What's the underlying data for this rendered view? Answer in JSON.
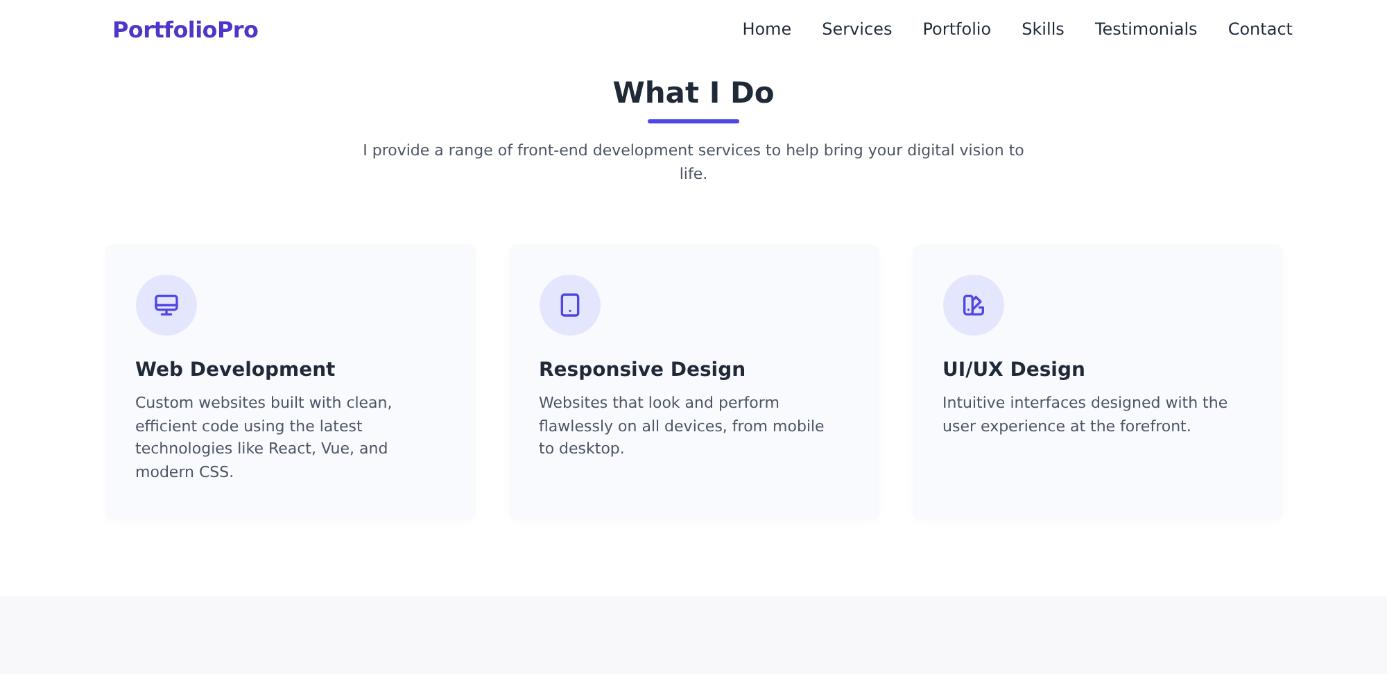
{
  "header": {
    "logo": "PortfolioPro",
    "nav": [
      {
        "label": "Home"
      },
      {
        "label": "Services"
      },
      {
        "label": "Portfolio"
      },
      {
        "label": "Skills"
      },
      {
        "label": "Testimonials"
      },
      {
        "label": "Contact"
      }
    ]
  },
  "section": {
    "title": "What I Do",
    "intro": "I provide a range of front-end development services to help bring your digital vision to life.",
    "services": [
      {
        "kind": "monitor",
        "title": "Web Development",
        "text": "Custom websites built with clean, efficient code using the latest technologies like React, Vue, and modern CSS."
      },
      {
        "kind": "tablet",
        "title": "Responsive Design",
        "text": "Websites that look and perform flawlessly on all devices, from mobile to desktop."
      },
      {
        "kind": "palette",
        "title": "UI/UX Design",
        "text": "Intuitive interfaces designed with the user experience at the forefront."
      }
    ]
  }
}
